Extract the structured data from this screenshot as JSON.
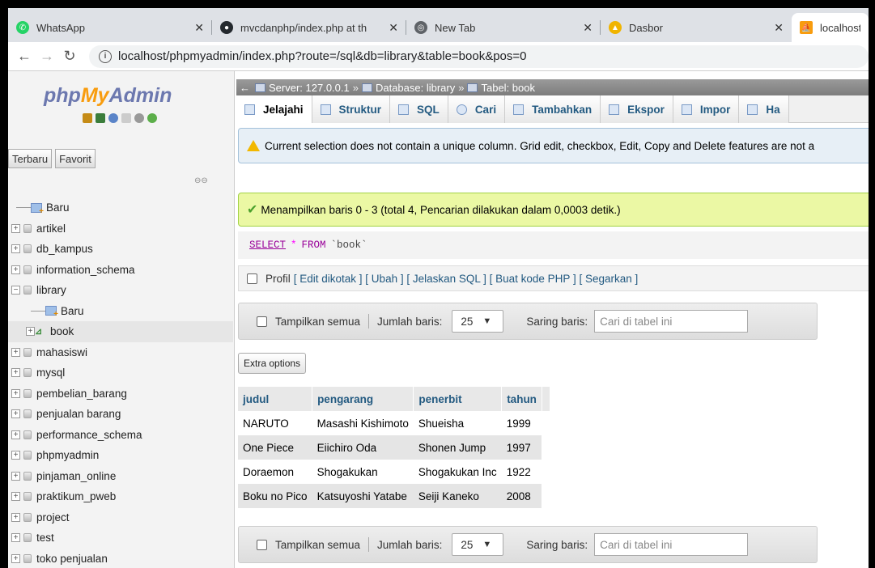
{
  "browser": {
    "tabs": [
      {
        "title": "WhatsApp",
        "color": "#25d366"
      },
      {
        "title": "mvcdanphp/index.php at th",
        "color": "#24292e"
      },
      {
        "title": "New Tab",
        "color": "#5f6368"
      },
      {
        "title": "Dasbor",
        "color": "#f0b400"
      },
      {
        "title": "localhost /",
        "color": "#f89c0e"
      }
    ],
    "url": "localhost/phpmyadmin/index.php?route=/sql&db=library&table=book&pos=0"
  },
  "sidebar": {
    "logo_php": "php",
    "logo_my": "My",
    "logo_admin": "Admin",
    "tabs": [
      "Terbaru",
      "Favorit"
    ],
    "new_label": "Baru",
    "databases": [
      "artikel",
      "db_kampus",
      "information_schema",
      "library",
      "mahasiswi",
      "mysql",
      "pembelian_barang",
      "penjualan barang",
      "performance_schema",
      "phpmyadmin",
      "pinjaman_online",
      "praktikum_pweb",
      "project",
      "test",
      "toko penjualan"
    ],
    "library_children": {
      "new": "Baru",
      "table": "book"
    }
  },
  "breadcrumb": {
    "server": "Server: 127.0.0.1",
    "database": "Database: library",
    "table": "Tabel: book"
  },
  "menu": [
    "Jelajahi",
    "Struktur",
    "SQL",
    "Cari",
    "Tambahkan",
    "Ekspor",
    "Impor",
    "Ha"
  ],
  "warning": "Current selection does not contain a unique column. Grid edit, checkbox, Edit, Copy and Delete features are not a",
  "success": "Menampilkan baris 0 - 3 (total 4, Pencarian dilakukan dalam 0,0003 detik.)",
  "sql": {
    "select": "SELECT",
    "star": "*",
    "from": "FROM",
    "table": "`book`"
  },
  "profil": {
    "label": "Profil",
    "links": "[ Edit dikotak ] [ Ubah ] [ Jelaskan SQL ] [ Buat kode PHP ] [ Segarkan ]"
  },
  "nav": {
    "show_all": "Tampilkan semua",
    "rows_label": "Jumlah baris:",
    "rows_value": "25",
    "filter_label": "Saring baris:",
    "filter_placeholder": "Cari di tabel ini"
  },
  "extra_options": "Extra options",
  "table": {
    "columns": [
      "judul",
      "pengarang",
      "penerbit",
      "tahun"
    ],
    "rows": [
      [
        "NARUTO",
        "Masashi Kishimoto",
        "Shueisha",
        "1999"
      ],
      [
        "One Piece",
        "Eiichiro Oda",
        "Shonen Jump",
        "1997"
      ],
      [
        "Doraemon",
        "Shogakukan",
        "Shogakukan Inc",
        "1922"
      ],
      [
        "Boku no Pico",
        "Katsuyoshi Yatabe",
        "Seiji Kaneko",
        "2008"
      ]
    ]
  }
}
